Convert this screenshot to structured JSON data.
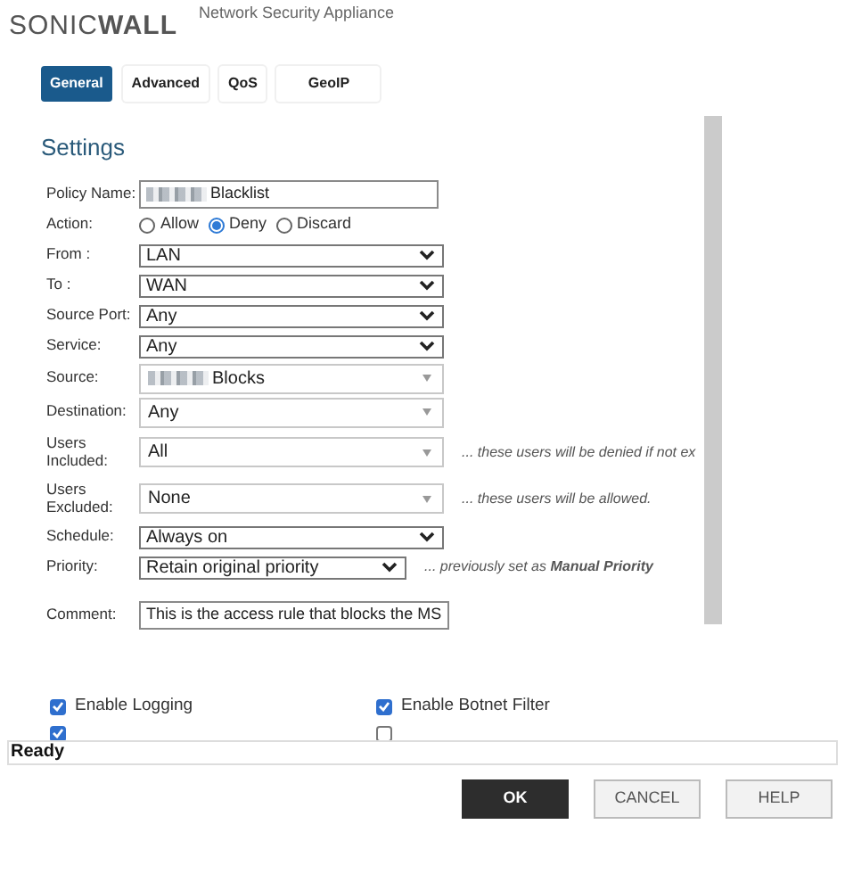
{
  "header": {
    "logo": "SONIC**WALL**",
    "subtitle": "Network Security Appliance"
  },
  "tabs": [
    {
      "label": "General",
      "selected": true
    },
    {
      "label": "Advanced",
      "selected": false
    },
    {
      "label": "QoS",
      "selected": false
    },
    {
      "label": "GeoIP",
      "selected": false
    }
  ],
  "section_title": "Settings",
  "fields": [
    {
      "kind": "text",
      "label": "Policy Name:",
      "redacted": true,
      "value": "Blacklist"
    },
    {
      "kind": "radio",
      "label": "Action:",
      "options": [
        {
          "label": "Allow",
          "selected": false
        },
        {
          "label": "Deny",
          "selected": true
        },
        {
          "label": "Discard",
          "selected": false
        }
      ]
    },
    {
      "kind": "select",
      "label": "From :",
      "value": "LAN"
    },
    {
      "kind": "select",
      "label": "To :",
      "value": "WAN"
    },
    {
      "kind": "select",
      "label": "Source Port:",
      "value": "Any"
    },
    {
      "kind": "select",
      "label": "Service:",
      "value": "Any"
    },
    {
      "kind": "picker",
      "label": "Source:",
      "redacted": true,
      "value": "Blocks"
    },
    {
      "kind": "picker",
      "label": "Destination:",
      "value": "Any"
    },
    {
      "kind": "picker",
      "label": "Users Included:",
      "value": "All",
      "hint": "... these users will be denied if not ex"
    },
    {
      "kind": "picker",
      "label": "Users Excluded:",
      "value": "None",
      "hint": "... these users will be allowed."
    },
    {
      "kind": "select",
      "label": "Schedule:",
      "value": "Always on"
    },
    {
      "kind": "short-select",
      "label": "Priority:",
      "value": "Retain original priority",
      "hint": "... previously set as **Manual Priority**"
    },
    {
      "kind": "text",
      "label": "Comment:",
      "value": "This is the access rule that blocks the MS"
    }
  ],
  "options": [
    {
      "label": "Enable Logging",
      "checked": true
    },
    {
      "label": "Enable Botnet Filter",
      "checked": true
    },
    {
      "checked": true
    },
    {
      "checked": false
    }
  ],
  "status_bar": "Ready",
  "buttons": [
    {
      "label": "OK",
      "primary": true
    },
    {
      "label": "CANCEL",
      "primary": false
    },
    {
      "label": "HELP",
      "primary": false
    }
  ]
}
